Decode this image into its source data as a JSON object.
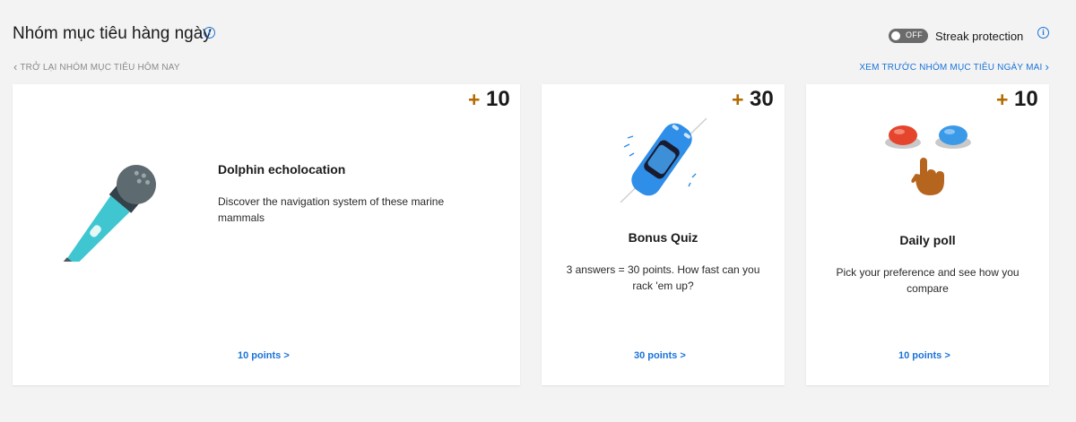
{
  "header": {
    "title": "Nhóm mục tiêu hàng ngày",
    "toggle_state": "OFF",
    "streak_label": "Streak protection"
  },
  "nav": {
    "back_label": "TRỞ LẠI NHÓM MỤC TIÊU HÔM NAY",
    "next_label": "XEM TRƯỚC NHÓM MỤC TIÊU NGÀY MAI"
  },
  "cards": [
    {
      "plus": "+",
      "points": "10",
      "title": "Dolphin echolocation",
      "description": "Discover the navigation system of these marine mammals",
      "link": "10 points >",
      "icon": "microphone-icon"
    },
    {
      "plus": "+",
      "points": "30",
      "title": "Bonus Quiz",
      "description": "3 answers = 30 points. How fast can you rack 'em up?",
      "link": "30 points >",
      "icon": "car-icon"
    },
    {
      "plus": "+",
      "points": "10",
      "title": "Daily poll",
      "description": "Pick your preference and see how you compare",
      "link": "10 points >",
      "icon": "buttons-hand-icon"
    }
  ],
  "colors": {
    "accent": "#1a73d9",
    "plus": "#b46a00",
    "background": "#f3f3f3"
  }
}
